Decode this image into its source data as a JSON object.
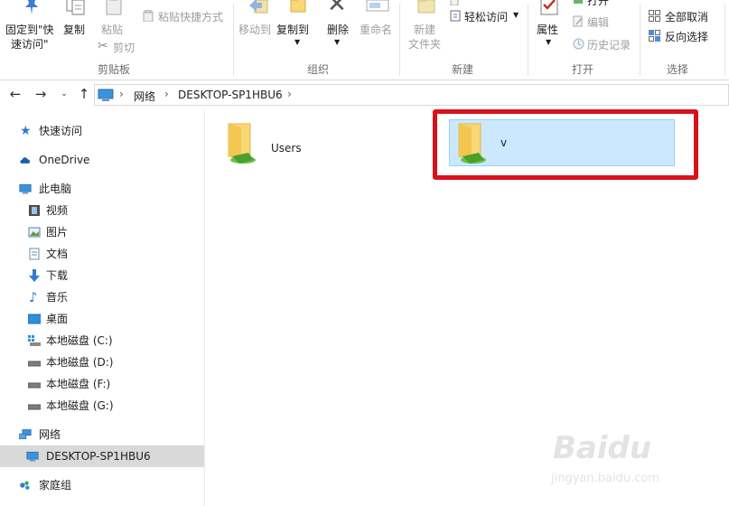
{
  "ribbon": {
    "clipboard": {
      "label": "剪贴板",
      "pin_line1": "固定到\"快",
      "pin_line2": "速访问\"",
      "copy": "复制",
      "paste": "粘贴",
      "paste_shortcut": "粘贴快捷方式",
      "cut": "剪切"
    },
    "organize": {
      "label": "组织",
      "move_to": "移动到",
      "copy_to": "复制到",
      "delete": "删除",
      "rename": "重命名"
    },
    "new": {
      "label": "新建",
      "new_folder_line1": "新建",
      "new_folder_line2": "文件夹",
      "easy_access": "轻松访问"
    },
    "open": {
      "label": "打开",
      "properties": "属性",
      "open": "打开",
      "edit": "编辑",
      "history": "历史记录"
    },
    "select": {
      "label": "选择",
      "select_none": "全部取消",
      "invert_selection": "反向选择"
    }
  },
  "address": {
    "crumbs": [
      "网络",
      "DESKTOP-SP1HBU6"
    ]
  },
  "sidebar": {
    "items": [
      {
        "label": "快速访问"
      },
      {
        "label": "OneDrive"
      },
      {
        "label": "此电脑"
      },
      {
        "label": "视频"
      },
      {
        "label": "图片"
      },
      {
        "label": "文档"
      },
      {
        "label": "下载"
      },
      {
        "label": "音乐"
      },
      {
        "label": "桌面"
      },
      {
        "label": "本地磁盘 (C:)"
      },
      {
        "label": "本地磁盘 (D:)"
      },
      {
        "label": "本地磁盘 (F:)"
      },
      {
        "label": "本地磁盘 (G:)"
      },
      {
        "label": "网络"
      },
      {
        "label": "DESKTOP-SP1HBU6"
      },
      {
        "label": "家庭组"
      }
    ]
  },
  "content": {
    "items": [
      {
        "name": "Users"
      },
      {
        "name": "v"
      }
    ]
  },
  "watermark": {
    "brand": "Baidu",
    "url": "jingyan.baidu.com"
  },
  "colors": {
    "selection_fill": "#cce8ff",
    "selection_border": "#99d1ff",
    "highlight_box": "#d9121a",
    "folder_yellow": "#f8d775"
  }
}
